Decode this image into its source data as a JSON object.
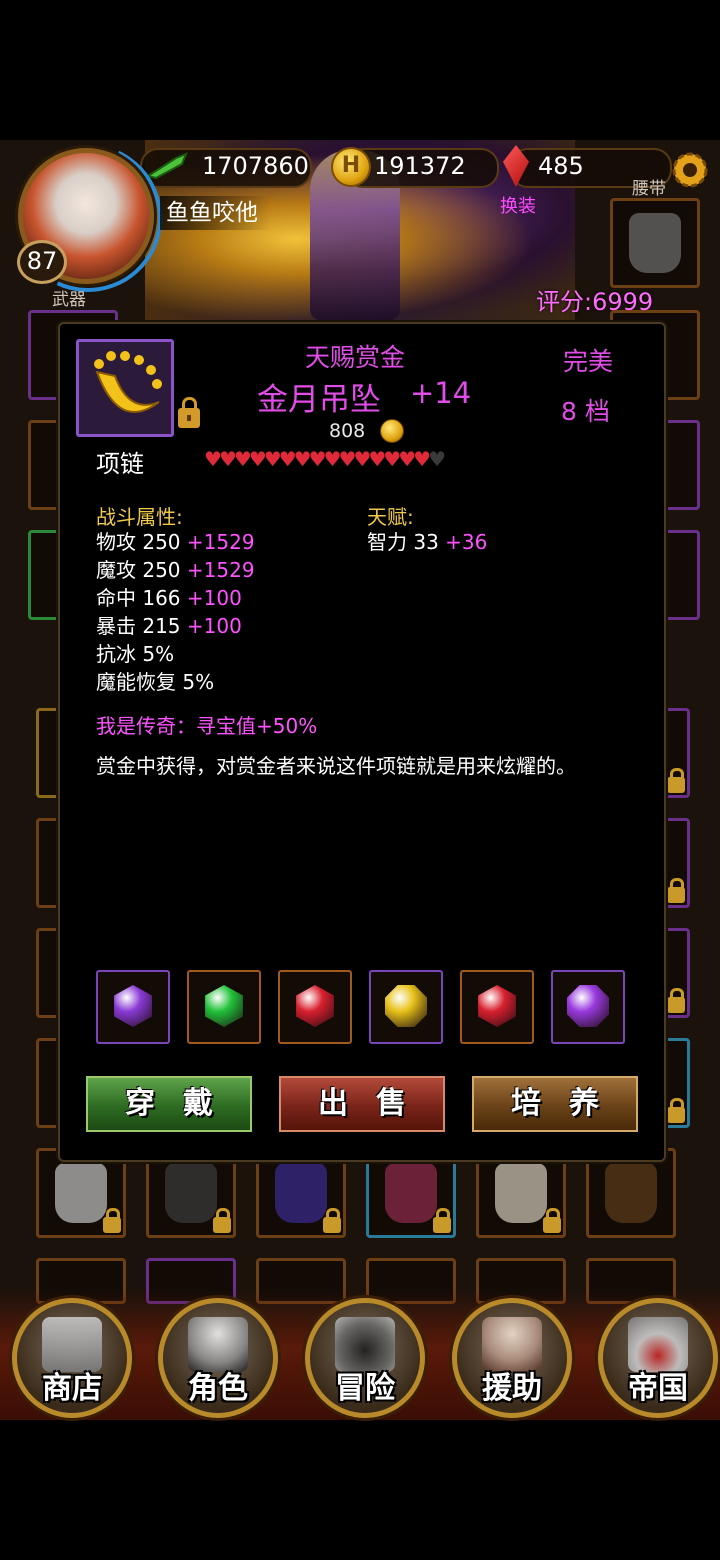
{
  "hud": {
    "power": "1707860",
    "gold": "191372",
    "gems": "485",
    "player_name": "鱼鱼咬他",
    "level": "87",
    "score": "评分:6999",
    "equip_label": "换装",
    "labels": {
      "weapon": "武器",
      "belt": "腰带"
    },
    "coin_symbol": "H"
  },
  "item": {
    "subtitle": "天赐赏金",
    "name": "金月吊坠",
    "enhance": "+14",
    "quality": "完美",
    "grade": "8 档",
    "price": "808",
    "type": "项链",
    "hearts_filled": 15,
    "hearts_total": 16,
    "combat_header": "战斗属性:",
    "combat_stats": [
      {
        "name": "物攻 250 ",
        "bonus": "+1529"
      },
      {
        "name": "魔攻 250 ",
        "bonus": "+1529"
      },
      {
        "name": "命中 166 ",
        "bonus": "+100"
      },
      {
        "name": "暴击 215 ",
        "bonus": "+100"
      },
      {
        "name": "抗冰 5%",
        "bonus": ""
      },
      {
        "name": "魔能恢复 5%",
        "bonus": ""
      }
    ],
    "talent_header": "天赋:",
    "talent_stats": [
      {
        "name": "智力 33 ",
        "bonus": "+36"
      }
    ],
    "legend": "我是传奇：寻宝值+50%",
    "description": "赏金中获得，对赏金者来说这件项链就是用来炫耀的。",
    "gems": [
      {
        "color": "purple",
        "hex": "#8a3ad6"
      },
      {
        "color": "green",
        "hex": "#22c23a"
      },
      {
        "color": "red",
        "hex": "#d8202e"
      },
      {
        "color": "yellow",
        "hex": "#e8c21a"
      },
      {
        "color": "red",
        "hex": "#d8202e"
      },
      {
        "color": "violet",
        "hex": "#9a3ae0"
      }
    ]
  },
  "actions": {
    "wear": "穿戴",
    "sell": "出售",
    "train": "培养"
  },
  "nav": [
    {
      "label": "商店",
      "icon": "castle-icon"
    },
    {
      "label": "角色",
      "icon": "hooded-figure-icon"
    },
    {
      "label": "冒险",
      "icon": "crossed-swords-gate-icon"
    },
    {
      "label": "援助",
      "icon": "companion-icon"
    },
    {
      "label": "帝国",
      "icon": "crown-icon"
    }
  ]
}
